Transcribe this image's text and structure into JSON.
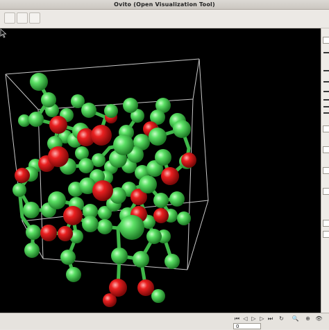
{
  "window": {
    "title": "Ovito (Open Visualization Tool)"
  },
  "toolbar": {
    "buttons": [
      "tool-1",
      "tool-2",
      "tool-3"
    ]
  },
  "animation": {
    "frame": "0",
    "buttons": [
      {
        "name": "goto-start",
        "glyph": "⏮"
      },
      {
        "name": "prev-frame",
        "glyph": "◁"
      },
      {
        "name": "play",
        "glyph": "▷"
      },
      {
        "name": "next-frame",
        "glyph": "▷"
      },
      {
        "name": "goto-end",
        "glyph": "⏭"
      },
      {
        "name": "loop",
        "glyph": "↻"
      },
      {
        "name": "zoom",
        "glyph": "🔍"
      },
      {
        "name": "fov",
        "glyph": "⊕"
      }
    ]
  },
  "colors": {
    "atom_green": "#4fd45a",
    "atom_red": "#e01818",
    "viewport_bg": "#000000",
    "cell_edge": "#c8c8c8"
  },
  "scene": {
    "cell_edges": [
      [
        [
          8,
          66
        ],
        [
          287,
          44
        ]
      ],
      [
        [
          287,
          44
        ],
        [
          300,
          248
        ]
      ],
      [
        [
          300,
          248
        ],
        [
          32,
          278
        ]
      ],
      [
        [
          32,
          278
        ],
        [
          8,
          66
        ]
      ],
      [
        [
          55,
          117
        ],
        [
          278,
          102
        ]
      ],
      [
        [
          278,
          102
        ],
        [
          270,
          348
        ]
      ],
      [
        [
          270,
          348
        ],
        [
          62,
          332
        ]
      ],
      [
        [
          62,
          332
        ],
        [
          55,
          117
        ]
      ],
      [
        [
          8,
          66
        ],
        [
          55,
          117
        ]
      ],
      [
        [
          287,
          44
        ],
        [
          278,
          102
        ]
      ],
      [
        [
          300,
          248
        ],
        [
          270,
          348
        ]
      ],
      [
        [
          32,
          278
        ],
        [
          62,
          332
        ]
      ]
    ],
    "bonds": [
      [
        [
          56,
          77
        ],
        [
          70,
          103
        ]
      ],
      [
        [
          70,
          103
        ],
        [
          52,
          131
        ]
      ],
      [
        [
          52,
          131
        ],
        [
          35,
          133
        ]
      ],
      [
        [
          52,
          131
        ],
        [
          84,
          139
        ]
      ],
      [
        [
          84,
          139
        ],
        [
          116,
          148
        ]
      ],
      [
        [
          116,
          148
        ],
        [
          127,
          157
        ]
      ],
      [
        [
          127,
          157
        ],
        [
          108,
          161
        ]
      ],
      [
        [
          108,
          161
        ],
        [
          94,
          156
        ]
      ],
      [
        [
          84,
          139
        ],
        [
          79,
          166
        ]
      ],
      [
        [
          79,
          166
        ],
        [
          67,
          195
        ]
      ],
      [
        [
          67,
          195
        ],
        [
          51,
          198
        ]
      ],
      [
        [
          67,
          195
        ],
        [
          98,
          199
        ]
      ],
      [
        [
          98,
          199
        ],
        [
          124,
          198
        ]
      ],
      [
        [
          124,
          198
        ],
        [
          142,
          190
        ]
      ],
      [
        [
          142,
          190
        ],
        [
          158,
          172
        ]
      ],
      [
        [
          158,
          172
        ],
        [
          178,
          168
        ]
      ],
      [
        [
          178,
          168
        ],
        [
          204,
          164
        ]
      ],
      [
        [
          204,
          164
        ],
        [
          227,
          156
        ]
      ],
      [
        [
          227,
          156
        ],
        [
          262,
          145
        ]
      ],
      [
        [
          262,
          145
        ],
        [
          272,
          173
        ]
      ],
      [
        [
          272,
          173
        ],
        [
          269,
          192
        ]
      ],
      [
        [
          269,
          192
        ],
        [
          245,
          213
        ]
      ],
      [
        [
          245,
          213
        ],
        [
          223,
          202
        ]
      ],
      [
        [
          223,
          202
        ],
        [
          205,
          208
        ]
      ],
      [
        [
          205,
          208
        ],
        [
          200,
          243
        ]
      ],
      [
        [
          200,
          243
        ],
        [
          184,
          270
        ]
      ],
      [
        [
          184,
          270
        ],
        [
          170,
          288
        ]
      ],
      [
        [
          170,
          288
        ],
        [
          151,
          286
        ]
      ],
      [
        [
          151,
          286
        ],
        [
          130,
          282
        ]
      ],
      [
        [
          130,
          282
        ],
        [
          105,
          270
        ]
      ],
      [
        [
          105,
          270
        ],
        [
          94,
          296
        ]
      ],
      [
        [
          94,
          296
        ],
        [
          70,
          295
        ]
      ],
      [
        [
          70,
          295
        ],
        [
          48,
          294
        ]
      ],
      [
        [
          48,
          294
        ],
        [
          32,
          272
        ]
      ],
      [
        [
          32,
          272
        ],
        [
          28,
          233
        ]
      ],
      [
        [
          28,
          233
        ],
        [
          44,
          210
        ]
      ],
      [
        [
          44,
          210
        ],
        [
          67,
          195
        ]
      ],
      [
        [
          28,
          233
        ],
        [
          45,
          262
        ]
      ],
      [
        [
          45,
          262
        ],
        [
          70,
          262
        ]
      ],
      [
        [
          70,
          262
        ],
        [
          82,
          248
        ]
      ],
      [
        [
          82,
          248
        ],
        [
          110,
          254
        ]
      ],
      [
        [
          110,
          254
        ],
        [
          130,
          264
        ]
      ],
      [
        [
          130,
          264
        ],
        [
          151,
          266
        ]
      ],
      [
        [
          151,
          266
        ],
        [
          164,
          253
        ]
      ],
      [
        [
          164,
          253
        ],
        [
          146,
          234
        ]
      ],
      [
        [
          146,
          234
        ],
        [
          126,
          227
        ]
      ],
      [
        [
          126,
          227
        ],
        [
          109,
          232
        ]
      ],
      [
        [
          146,
          234
        ],
        [
          170,
          241
        ]
      ],
      [
        [
          170,
          241
        ],
        [
          186,
          232
        ]
      ],
      [
        [
          186,
          232
        ],
        [
          200,
          243
        ]
      ],
      [
        [
          186,
          232
        ],
        [
          213,
          225
        ]
      ],
      [
        [
          213,
          225
        ],
        [
          232,
          248
        ]
      ],
      [
        [
          232,
          248
        ],
        [
          246,
          270
        ]
      ],
      [
        [
          246,
          270
        ],
        [
          265,
          274
        ]
      ],
      [
        [
          232,
          248
        ],
        [
          255,
          246
        ]
      ],
      [
        [
          213,
          225
        ],
        [
          207,
          214
        ]
      ],
      [
        [
          105,
          270
        ],
        [
          110,
          300
        ]
      ],
      [
        [
          110,
          300
        ],
        [
          98,
          330
        ]
      ],
      [
        [
          98,
          330
        ],
        [
          106,
          355
        ]
      ],
      [
        [
          48,
          294
        ],
        [
          46,
          320
        ]
      ],
      [
        [
          170,
          288
        ],
        [
          172,
          328
        ]
      ],
      [
        [
          172,
          328
        ],
        [
          170,
          374
        ]
      ],
      [
        [
          170,
          374
        ],
        [
          158,
          392
        ]
      ],
      [
        [
          172,
          328
        ],
        [
          203,
          333
        ]
      ],
      [
        [
          203,
          333
        ],
        [
          210,
          374
        ]
      ],
      [
        [
          210,
          374
        ],
        [
          228,
          386
        ]
      ],
      [
        [
          203,
          333
        ],
        [
          222,
          300
        ]
      ],
      [
        [
          222,
          300
        ],
        [
          236,
          300
        ]
      ],
      [
        [
          236,
          300
        ],
        [
          248,
          336
        ]
      ],
      [
        [
          222,
          300
        ],
        [
          214,
          279
        ]
      ],
      [
        [
          214,
          279
        ],
        [
          200,
          243
        ]
      ],
      [
        [
          188,
          111
        ],
        [
          198,
          126
        ]
      ],
      [
        [
          198,
          126
        ],
        [
          182,
          150
        ]
      ],
      [
        [
          182,
          150
        ],
        [
          178,
          168
        ]
      ],
      [
        [
          112,
          105
        ],
        [
          128,
          118
        ]
      ],
      [
        [
          128,
          118
        ],
        [
          152,
          128
        ]
      ],
      [
        [
          152,
          128
        ],
        [
          144,
          153
        ]
      ],
      [
        [
          144,
          153
        ],
        [
          124,
          157
        ]
      ],
      [
        [
          160,
          119
        ],
        [
          152,
          128
        ]
      ],
      [
        [
          235,
          111
        ],
        [
          227,
          128
        ]
      ],
      [
        [
          227,
          128
        ],
        [
          218,
          146
        ]
      ],
      [
        [
          218,
          146
        ],
        [
          227,
          156
        ]
      ],
      [
        [
          256,
          134
        ],
        [
          262,
          145
        ]
      ],
      [
        [
          235,
          186
        ],
        [
          245,
          213
        ]
      ]
    ],
    "atoms_green": [
      [
        56,
        77,
        13
      ],
      [
        70,
        103,
        11
      ],
      [
        52,
        131,
        11
      ],
      [
        35,
        133,
        9
      ],
      [
        116,
        148,
        12
      ],
      [
        108,
        161,
        11
      ],
      [
        94,
        156,
        10
      ],
      [
        79,
        166,
        11
      ],
      [
        51,
        198,
        10
      ],
      [
        98,
        199,
        12
      ],
      [
        124,
        198,
        11
      ],
      [
        142,
        190,
        10
      ],
      [
        178,
        168,
        15
      ],
      [
        204,
        164,
        12
      ],
      [
        227,
        156,
        13
      ],
      [
        262,
        145,
        13
      ],
      [
        269,
        192,
        11
      ],
      [
        223,
        202,
        12
      ],
      [
        205,
        208,
        11
      ],
      [
        184,
        270,
        12
      ],
      [
        151,
        286,
        11
      ],
      [
        130,
        282,
        12
      ],
      [
        94,
        296,
        11
      ],
      [
        70,
        295,
        12
      ],
      [
        48,
        294,
        11
      ],
      [
        28,
        233,
        10
      ],
      [
        44,
        210,
        11
      ],
      [
        45,
        262,
        12
      ],
      [
        70,
        262,
        11
      ],
      [
        82,
        248,
        13
      ],
      [
        110,
        254,
        11
      ],
      [
        130,
        264,
        11
      ],
      [
        151,
        266,
        10
      ],
      [
        164,
        253,
        11
      ],
      [
        126,
        227,
        12
      ],
      [
        109,
        232,
        11
      ],
      [
        170,
        241,
        12
      ],
      [
        186,
        232,
        11
      ],
      [
        213,
        225,
        13
      ],
      [
        232,
        248,
        11
      ],
      [
        246,
        270,
        10
      ],
      [
        265,
        274,
        10
      ],
      [
        255,
        246,
        11
      ],
      [
        110,
        300,
        10
      ],
      [
        98,
        330,
        11
      ],
      [
        106,
        355,
        11
      ],
      [
        46,
        320,
        11
      ],
      [
        172,
        328,
        12
      ],
      [
        203,
        333,
        12
      ],
      [
        228,
        386,
        10
      ],
      [
        222,
        300,
        11
      ],
      [
        236,
        300,
        10
      ],
      [
        248,
        336,
        11
      ],
      [
        214,
        279,
        10
      ],
      [
        188,
        111,
        11
      ],
      [
        198,
        126,
        10
      ],
      [
        182,
        150,
        11
      ],
      [
        112,
        105,
        10
      ],
      [
        128,
        118,
        11
      ],
      [
        144,
        153,
        11
      ],
      [
        160,
        119,
        10
      ],
      [
        235,
        111,
        11
      ],
      [
        227,
        128,
        11
      ],
      [
        218,
        146,
        11
      ],
      [
        256,
        134,
        12
      ],
      [
        235,
        186,
        12
      ],
      [
        170,
        188,
        13
      ],
      [
        186,
        198,
        11
      ],
      [
        160,
        200,
        10
      ],
      [
        140,
        214,
        11
      ],
      [
        118,
        180,
        10
      ],
      [
        195,
        182,
        12
      ],
      [
        75,
        118,
        10
      ],
      [
        96,
        125,
        10
      ],
      [
        190,
        287,
        18
      ],
      [
        153,
        215,
        10
      ]
    ],
    "atoms_red": [
      [
        84,
        139,
        13
      ],
      [
        84,
        185,
        15
      ],
      [
        67,
        195,
        12
      ],
      [
        32,
        212,
        11
      ],
      [
        146,
        154,
        15
      ],
      [
        124,
        157,
        13
      ],
      [
        148,
        234,
        15
      ],
      [
        200,
        243,
        12
      ],
      [
        245,
        213,
        13
      ],
      [
        272,
        190,
        11
      ],
      [
        105,
        270,
        14
      ],
      [
        70,
        295,
        12
      ],
      [
        94,
        296,
        11
      ],
      [
        200,
        268,
        12
      ],
      [
        232,
        270,
        11
      ],
      [
        170,
        374,
        13
      ],
      [
        210,
        374,
        12
      ],
      [
        158,
        392,
        10
      ],
      [
        217,
        145,
        11
      ],
      [
        160,
        128,
        9
      ],
      [
        120,
        150,
        10
      ]
    ]
  }
}
